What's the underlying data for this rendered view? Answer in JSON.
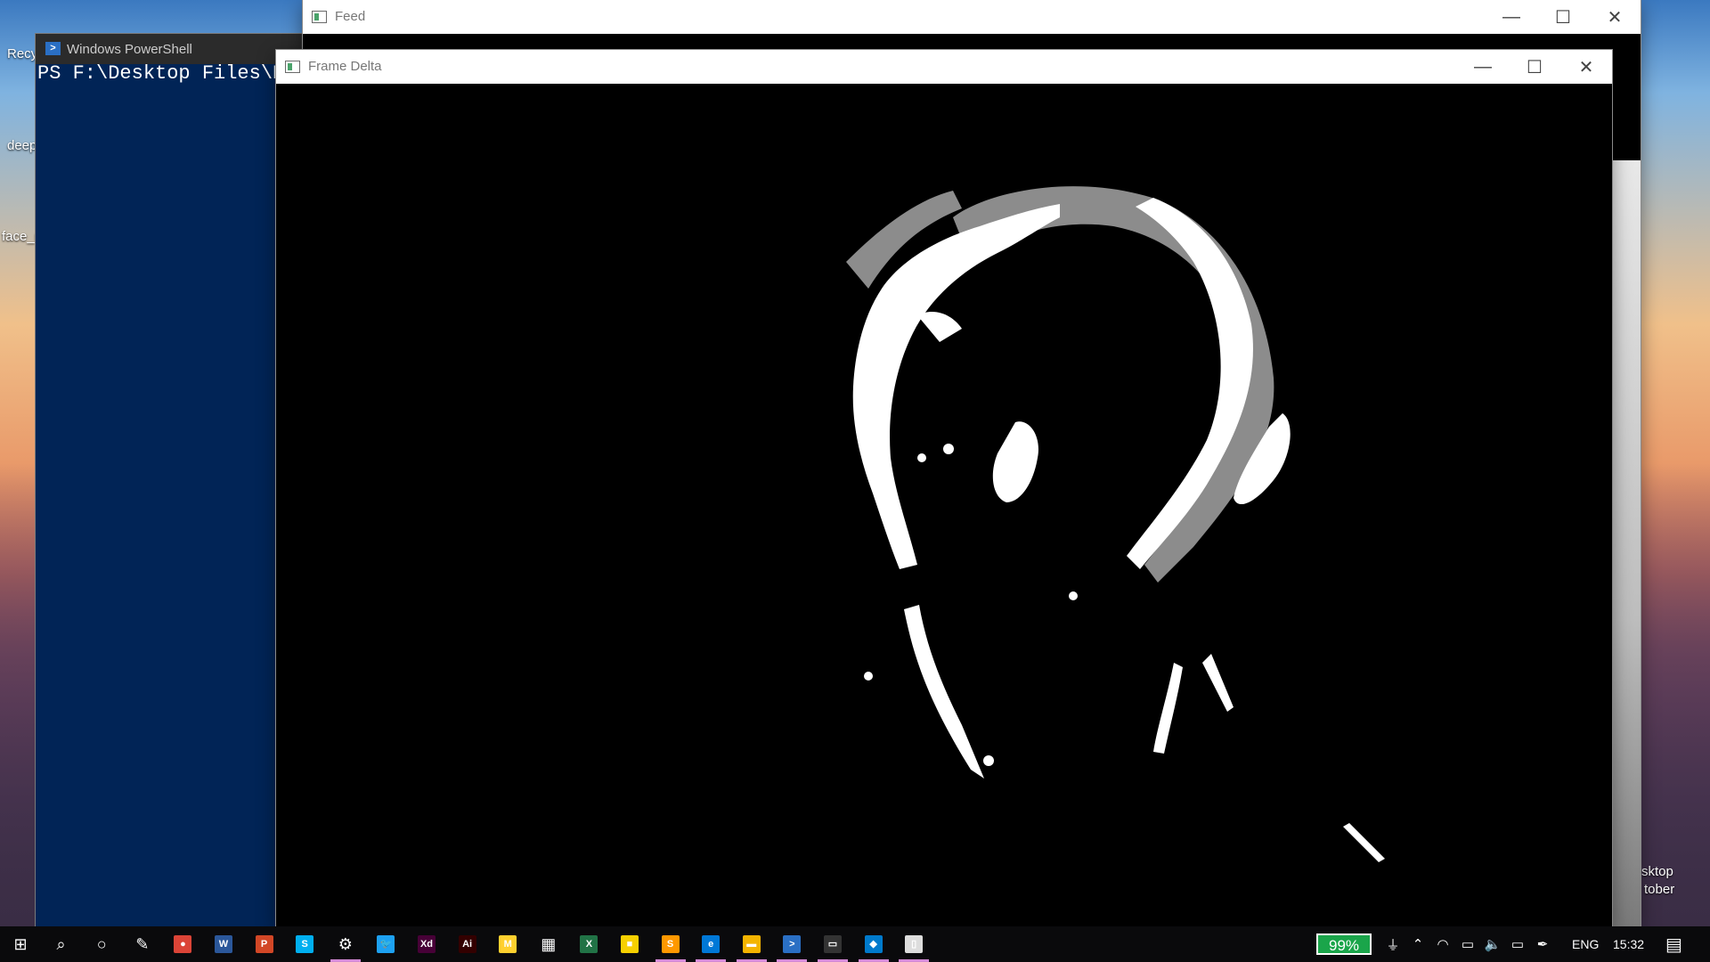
{
  "desktop": {
    "icons": [
      "Recy",
      "deep",
      "face_r",
      "sktop",
      "tober"
    ]
  },
  "powershell": {
    "title": "Windows PowerShell",
    "prompt": "PS F:\\Desktop Files\\Dra"
  },
  "feed_window": {
    "title": "Feed"
  },
  "frame_delta_window": {
    "title": "Frame Delta"
  },
  "window_controls": {
    "minimize": "—",
    "maximize": "☐",
    "close": "✕"
  },
  "taskbar": {
    "apps": [
      {
        "name": "windows-start-icon",
        "label": "⊞"
      },
      {
        "name": "search-icon",
        "label": "⌕"
      },
      {
        "name": "cortana-icon",
        "label": "○"
      },
      {
        "name": "pen-icon",
        "label": "✎"
      },
      {
        "name": "chrome-icon",
        "label": "●"
      },
      {
        "name": "word-icon",
        "label": "W"
      },
      {
        "name": "powerpoint-icon",
        "label": "P"
      },
      {
        "name": "skype-icon",
        "label": "S"
      },
      {
        "name": "settings-icon",
        "label": "⚙"
      },
      {
        "name": "twitter-icon",
        "label": "🐦"
      },
      {
        "name": "xd-icon",
        "label": "Xd"
      },
      {
        "name": "illustrator-icon",
        "label": "Ai"
      },
      {
        "name": "miro-icon",
        "label": "M"
      },
      {
        "name": "calculator-icon",
        "label": "▦"
      },
      {
        "name": "excel-icon",
        "label": "X"
      },
      {
        "name": "sticky-notes-icon",
        "label": "■"
      },
      {
        "name": "sublime-icon",
        "label": "S"
      },
      {
        "name": "edge-icon",
        "label": "e"
      },
      {
        "name": "file-explorer-icon",
        "label": "▬"
      },
      {
        "name": "powershell-icon",
        "label": ">"
      },
      {
        "name": "terminal-icon",
        "label": "▭"
      },
      {
        "name": "vscode-icon",
        "label": "◆"
      },
      {
        "name": "notepad-icon",
        "label": "▯"
      }
    ],
    "battery": "99%",
    "language": "ENG",
    "time": "15:32"
  }
}
